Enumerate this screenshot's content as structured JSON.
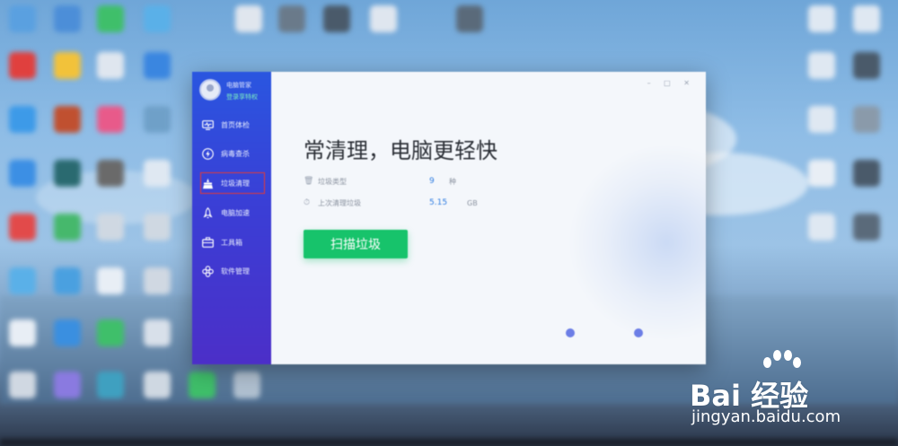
{
  "sidebar": {
    "profile": {
      "name": "电脑管家",
      "login": "登录享特权"
    },
    "items": [
      {
        "label": "首页体检",
        "icon": "monitor-icon"
      },
      {
        "label": "病毒查杀",
        "icon": "lightning-icon"
      },
      {
        "label": "垃圾清理",
        "icon": "broom-icon",
        "active": true
      },
      {
        "label": "电脑加速",
        "icon": "rocket-icon"
      },
      {
        "label": "工具箱",
        "icon": "toolbox-icon"
      },
      {
        "label": "软件管理",
        "icon": "apps-icon"
      }
    ]
  },
  "main": {
    "headline": "常清理，电脑更轻快",
    "stats": [
      {
        "label": "垃圾类型",
        "value": "9",
        "unit": "种",
        "icon": "trash-icon"
      },
      {
        "label": "上次清理垃圾",
        "value": "5.15",
        "unit": "GB",
        "icon": "clock-icon"
      }
    ],
    "scan_button": "扫描垃圾"
  },
  "watermark": {
    "brand": "Bai 经验",
    "url": "jingyan.baidu.com"
  },
  "colors": {
    "sidebar": "#2a56e0",
    "accent_green": "#17c36b",
    "value_blue": "#2f7de1",
    "highlight_red": "#e53935"
  }
}
